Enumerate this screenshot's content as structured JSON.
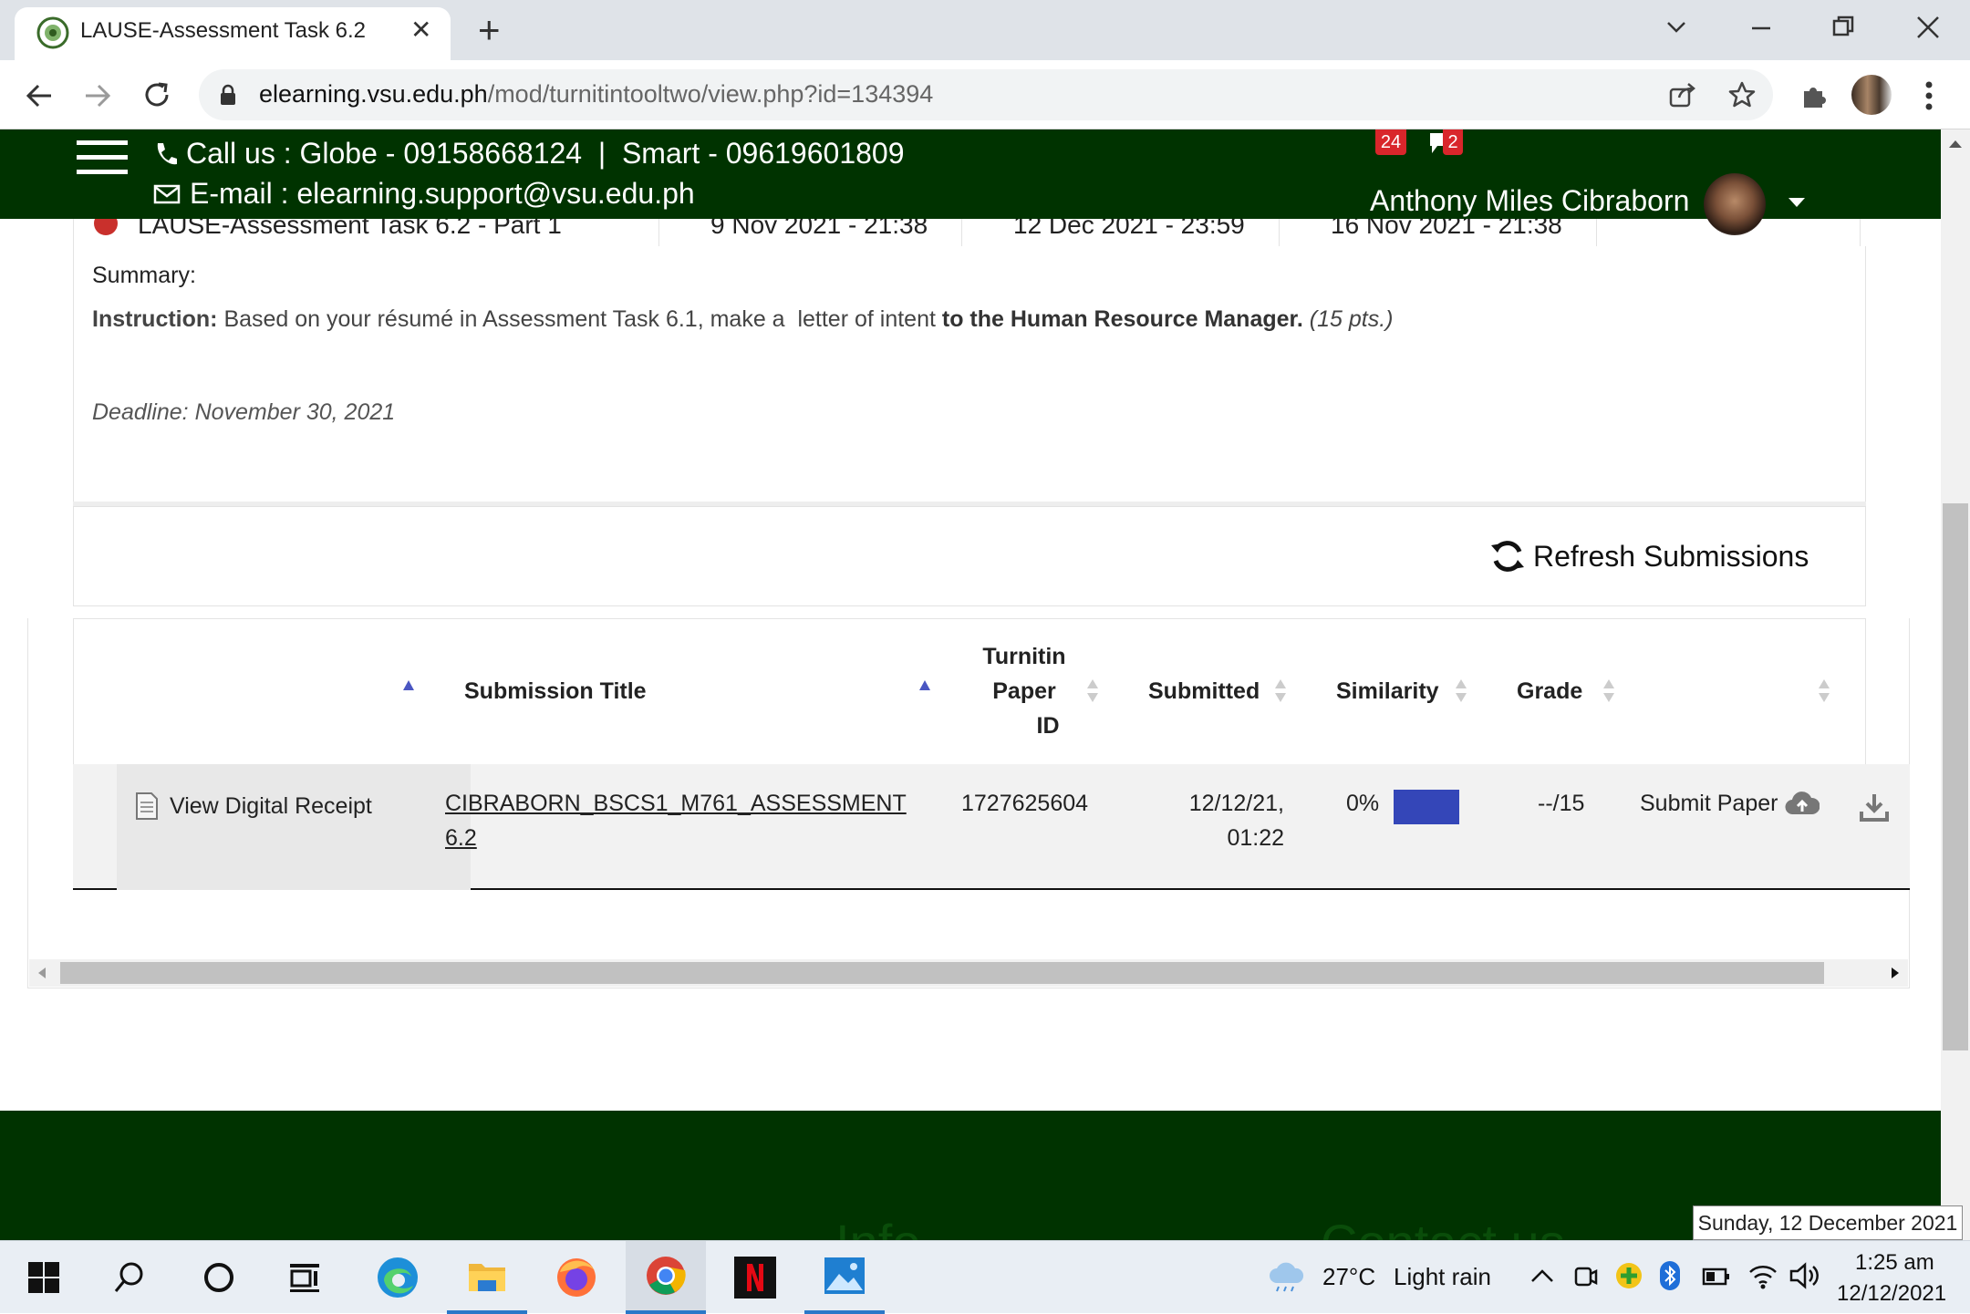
{
  "browser": {
    "tab_title": "LAUSE-Assessment Task 6.2",
    "url_host": "elearning.vsu.edu.ph",
    "url_path": "/mod/turnitintooltwo/view.php?id=134394",
    "new_tab_label": "+",
    "close_tab_label": "✕"
  },
  "header": {
    "call_us": "Call us : Globe - 09158668124  |  Smart - 09619601809",
    "email": "E-mail : elearning.support@vsu.edu.ph",
    "notif_count": "24",
    "msg_count": "2",
    "user_name": "Anthony Miles Cibraborn"
  },
  "hidden_row": {
    "title": "LAUSE-Assessment Task 6.2 - Part 1",
    "start": "9 Nov 2021 - 21:38",
    "due": "12 Dec 2021 - 23:59",
    "post": "16 Nov 2021 - 21:38"
  },
  "summary": {
    "label": "Summary:",
    "instruction_label": "Instruction:",
    "instruction_text": " Based on your résumé in Assessment Task 6.1, make a  letter of intent ",
    "instruction_bold": "to the Human Resource Manager.",
    "instruction_pts": " (15 pts.)",
    "deadline": "Deadline: November 30, 2021"
  },
  "refresh_label": "Refresh Submissions",
  "table": {
    "headers": {
      "title": "Submission Title",
      "paper_id_1": "Turnitin",
      "paper_id_2": "Paper",
      "paper_id_3": "ID",
      "submitted": "Submitted",
      "similarity": "Similarity",
      "grade": "Grade"
    },
    "row": {
      "receipt": "View Digital Receipt",
      "title_1": "CIBRABORN_BSCS1_M761_ASSESSMENT",
      "title_2": "6.2",
      "paper_id": "1727625604",
      "submitted_1": "12/12/21,",
      "submitted_2": "01:22",
      "similarity": "0%",
      "similarity_fraction": 0,
      "similarity_color": "#3446b8",
      "grade": "--/15",
      "submit_label": "Submit Paper"
    }
  },
  "footer": {
    "info": "Info",
    "contact": "Contact us"
  },
  "taskbar": {
    "weather_temp": "27°C",
    "weather_desc": "Light rain",
    "time": "1:25 am",
    "date": "12/12/2021",
    "tooltip": "Sunday, 12 December 2021"
  },
  "colors": {
    "site_green": "#003300",
    "sort_active": "#4a56c2",
    "notif_red": "#d9262b"
  }
}
